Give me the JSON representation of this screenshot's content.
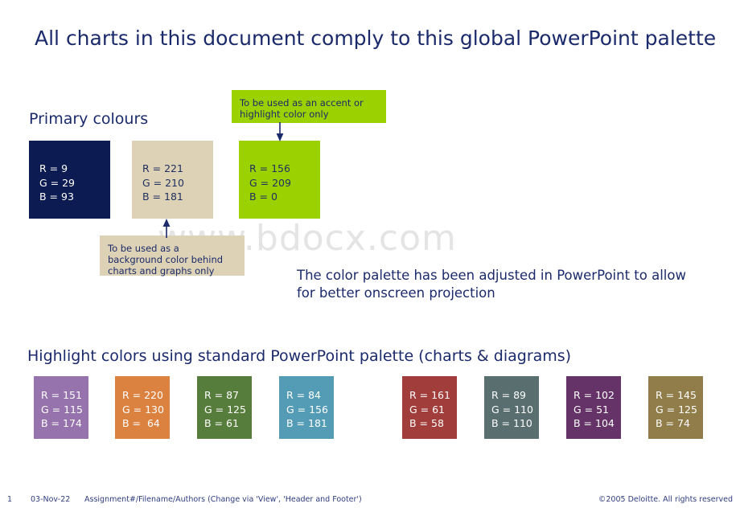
{
  "slide": {
    "title": "All charts in this document comply to this global PowerPoint palette",
    "watermark": "www.bdocx.com"
  },
  "primary_section": {
    "heading": "Primary colours",
    "swatches": [
      {
        "name": "navy",
        "hex": "#0c1b51",
        "r": 9,
        "g": 29,
        "b": 93,
        "rgb_text": "R = 9\nG = 29\nB = 93",
        "text_color": "#ffffff"
      },
      {
        "name": "tan",
        "hex": "#ddd2b5",
        "r": 221,
        "g": 210,
        "b": 181,
        "rgb_text": "R = 221\nG = 210\nB = 181",
        "text_color": "#20305f"
      },
      {
        "name": "green",
        "hex": "#9cd100",
        "r": 156,
        "g": 209,
        "b": 0,
        "rgb_text": "R = 156\nG = 209\nB = 0",
        "text_color": "#20305f"
      }
    ],
    "callout_accent": "To be used as an accent or highlight color only",
    "callout_background": "To be used as a background color behind charts and graphs only"
  },
  "adjusted_note": "The color palette has been adjusted in PowerPoint to allow for better onscreen projection",
  "highlight_section": {
    "heading": "Highlight colors using standard PowerPoint palette (charts & diagrams)",
    "group_one": [
      {
        "name": "purple",
        "hex": "#9773ae",
        "r": 151,
        "g": 115,
        "b": 174,
        "rgb_text": "R = 151\nG = 115\nB = 174"
      },
      {
        "name": "orange",
        "hex": "#dc8240",
        "r": 220,
        "g": 130,
        "b": 64,
        "rgb_text": "R = 220\nG = 130\nB =  64"
      },
      {
        "name": "green",
        "hex": "#577d3d",
        "r": 87,
        "g": 125,
        "b": 61,
        "rgb_text": "R = 87\nG = 125\nB = 61"
      },
      {
        "name": "blue",
        "hex": "#549cb5",
        "r": 84,
        "g": 156,
        "b": 181,
        "rgb_text": "R = 84\nG = 156\nB = 181"
      }
    ],
    "group_two": [
      {
        "name": "red",
        "hex": "#a13d3a",
        "r": 161,
        "g": 61,
        "b": 58,
        "rgb_text": "R = 161\nG = 61\nB = 58"
      },
      {
        "name": "slate",
        "hex": "#596e6e",
        "r": 89,
        "g": 110,
        "b": 110,
        "rgb_text": "R = 89\nG = 110\nB = 110"
      },
      {
        "name": "plum",
        "hex": "#663368",
        "r": 102,
        "g": 51,
        "b": 104,
        "rgb_text": "R = 102\nG = 51\nB = 104"
      },
      {
        "name": "olive",
        "hex": "#917d4a",
        "r": 145,
        "g": 125,
        "b": 74,
        "rgb_text": "R = 145\nG = 125\nB = 74"
      }
    ]
  },
  "footer": {
    "page_number": "1",
    "date": "03-Nov-22",
    "assignment": "Assignment#/Filename/Authors (Change via 'View', 'Header and Footer')",
    "copyright": "©2005 Deloitte. All rights reserved"
  },
  "theme": {
    "navy_text": "#1b2a6b",
    "accent_green": "#9cd100",
    "background_tan": "#ddd2b5"
  }
}
